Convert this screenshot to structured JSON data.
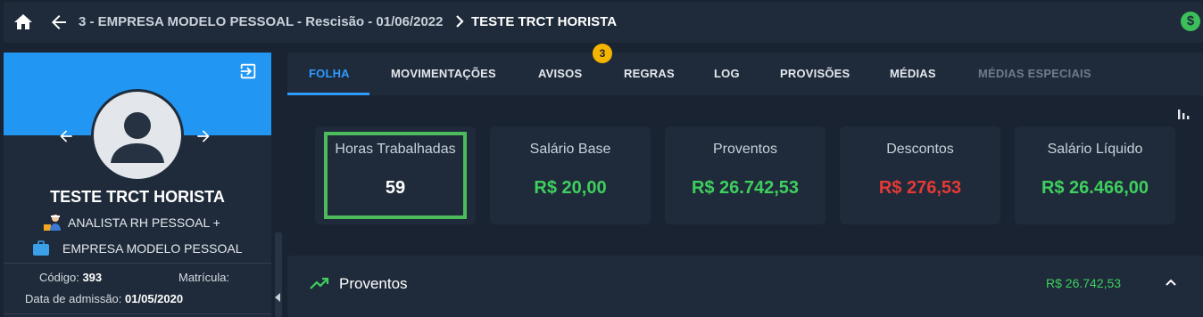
{
  "header": {
    "breadcrumb": "3 - EMPRESA MODELO PESSOAL - Rescisão - 01/06/2022",
    "current": "TESTE TRCT HORISTA",
    "currency_symbol": "$"
  },
  "employee": {
    "name": "TESTE TRCT HORISTA",
    "role": "ANALISTA RH PESSOAL +",
    "company": "EMPRESA MODELO PESSOAL",
    "codigo_label": "Código:",
    "codigo_value": "393",
    "matricula_label": "Matrícula:",
    "admissao_label": "Data de admissão:",
    "admissao_value": "01/05/2020"
  },
  "tabs": [
    {
      "label": "FOLHA",
      "state": "active"
    },
    {
      "label": "MOVIMENTAÇÕES",
      "state": "normal"
    },
    {
      "label": "AVISOS",
      "state": "normal",
      "badge": "3"
    },
    {
      "label": "REGRAS",
      "state": "normal"
    },
    {
      "label": "LOG",
      "state": "normal"
    },
    {
      "label": "PROVISÕES",
      "state": "normal"
    },
    {
      "label": "MÉDIAS",
      "state": "normal"
    },
    {
      "label": "MÉDIAS ESPECIAIS",
      "state": "disabled"
    }
  ],
  "cards": [
    {
      "label": "Horas Trabalhadas",
      "value": "59",
      "color": "#ffffff"
    },
    {
      "label": "Salário Base",
      "value": "R$ 20,00",
      "color": "#3fcf5e"
    },
    {
      "label": "Proventos",
      "value": "R$ 26.742,53",
      "color": "#3fcf5e"
    },
    {
      "label": "Descontos",
      "value": "R$ 276,53",
      "color": "#e53935"
    },
    {
      "label": "Salário Líquido",
      "value": "R$ 26.466,00",
      "color": "#3fcf5e"
    }
  ],
  "panel": {
    "title": "Proventos",
    "total": "R$ 26.742,53"
  },
  "colors": {
    "accent": "#2e9bff",
    "banner": "#2196f3",
    "highlight": "#4cbb5c",
    "badge": "#f5b400"
  }
}
